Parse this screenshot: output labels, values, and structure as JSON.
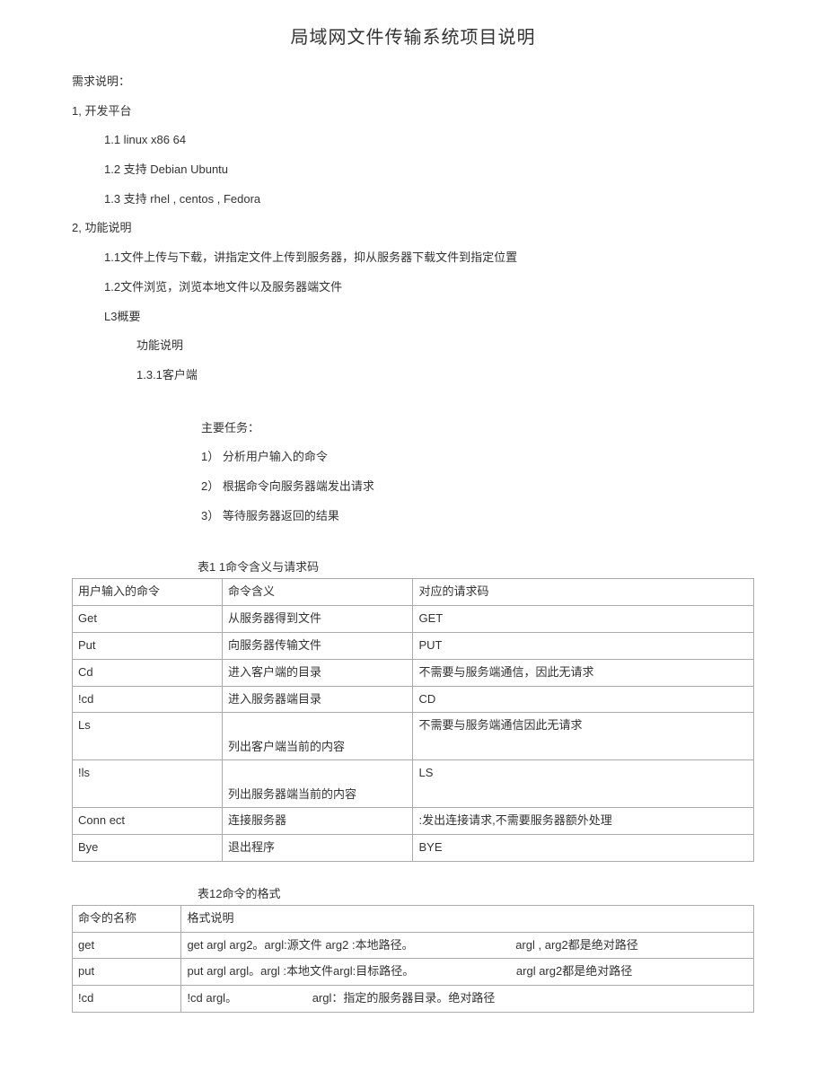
{
  "title": "局域网文件传输系统项目说明",
  "intro": "需求说明：",
  "sec1": {
    "heading": "1,  开发平台",
    "items": [
      "1.1   linux x86 64",
      "1.2   支持  Debian Ubuntu",
      "1.3   支持  rhel , centos , Fedora"
    ]
  },
  "sec2": {
    "heading": "2,  功能说明",
    "l1": "1.1文件上传与下载，讲指定文件上传到服务器，抑从服务器下载文件到指定位置",
    "l2": "1.2文件浏览，浏览本地文件以及服务器端文件",
    "l3": "L3概要",
    "l3sub": "功能说明",
    "l3sub2": "1.3.1客户端",
    "tasks_heading": "主要任务：",
    "tasks": [
      "1）  分析用户输入的命令",
      "2）  根据命令向服务器端发出请求",
      "3）  等待服务器返回的结果"
    ]
  },
  "table1": {
    "caption": "表1 1命令含义与请求码",
    "header": [
      "用户输入的命令",
      "命令含义",
      "对应的请求码"
    ],
    "rows": [
      [
        "Get",
        "从服务器得到文件",
        "GET"
      ],
      [
        "Put",
        "向服务器传输文件",
        "PUT"
      ],
      [
        "Cd",
        "进入客户端的目录",
        "不需要与服务端通信，因此无请求"
      ],
      [
        "!cd",
        "进入服务器端目录",
        "CD"
      ],
      [
        "Ls",
        "\n列出客户端当前的内容",
        "不需要与服务端通信因此无请求"
      ],
      [
        "!ls",
        "\n列出服务器端当前的内容",
        "LS"
      ],
      [
        "Conn ect",
        "连接服务器",
        ":发出连接请求,不需要服务器额外处理"
      ],
      [
        "Bye",
        "退出程序",
        "BYE"
      ]
    ]
  },
  "table2": {
    "caption": "表12命令的格式",
    "header": [
      "命令的名称",
      "格式说明"
    ],
    "rows": [
      {
        "name": "get",
        "fmt": "get argl arg2。argl:源文件  arg2 :本地路径。",
        "note": "argl , arg2都是绝对路径"
      },
      {
        "name": "put",
        "fmt": "put argl argl。argl :本地文件argl:目标路径。",
        "note": "argl arg2都是绝对路径"
      },
      {
        "name": "!cd",
        "fmt": "!cd argl。",
        "note": "argl：指定的服务器目录。绝对路径"
      }
    ]
  }
}
